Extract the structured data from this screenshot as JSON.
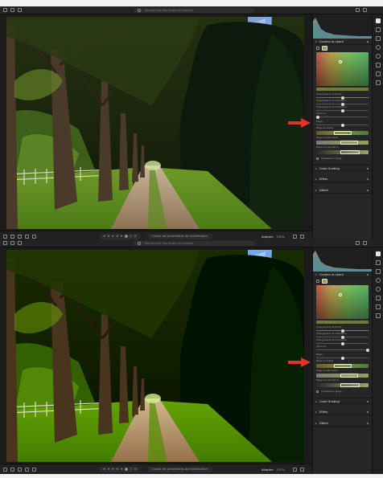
{
  "search": {
    "placeholder": "Rechercher des toutes les photos"
  },
  "toolbar": {
    "rating": "★ ★ ★ ★ ★  ⬤  ⓘ  ⊞",
    "copy_button": "Copier les paramètres de modification",
    "fit_label": "Adapter",
    "zoom": "100%"
  },
  "panel": {
    "point_color_title": "Couleur du point",
    "labels": {
      "hue_shift": "Changement de teinte",
      "sat_shift": "Changement de saturation",
      "lum_shift": "Changement de luminance",
      "variance": "Variance",
      "hue_range": "Plage de teinte",
      "sat_range": "Plage de saturation",
      "lum_range": "Plage de luminance",
      "visualize": "Visualiser la plage",
      "range": "Plage"
    },
    "sections": {
      "color_grading": "Color Grading",
      "effects": "Effets",
      "detail": "Détail"
    }
  },
  "states": [
    {
      "variance_value": 0.0
    },
    {
      "variance_value": 1.0
    }
  ],
  "icons": {
    "toolbar": [
      "grid-icon",
      "square-icon",
      "compare-icon",
      "people-icon",
      "sort-icon"
    ],
    "tools": [
      "sliders-icon",
      "crop-icon",
      "heal-icon",
      "mask-icon",
      "redeye-icon",
      "history-icon",
      "preset-icon",
      "more-icon"
    ]
  },
  "colors": {
    "annotation_arrow": "#e0342b",
    "panel_bg": "#262626",
    "app_bg": "#1b1b1b"
  }
}
